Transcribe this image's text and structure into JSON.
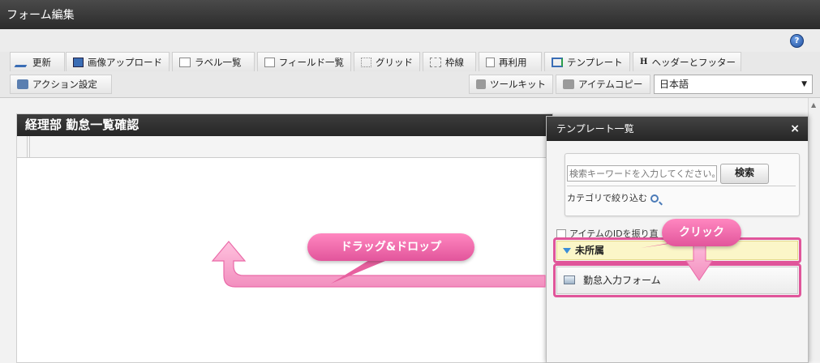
{
  "window": {
    "title": "フォーム編集"
  },
  "toolbar": {
    "row1": [
      {
        "label": "更新",
        "icon": "pencil-icon"
      },
      {
        "label": "画像アップロード",
        "icon": "image-upload-icon"
      },
      {
        "label": "ラベル一覧",
        "icon": "label-list-icon"
      },
      {
        "label": "フィールド一覧",
        "icon": "field-list-icon"
      },
      {
        "label": "グリッド",
        "icon": "grid-icon"
      },
      {
        "label": "枠線",
        "icon": "border-icon"
      },
      {
        "label": "再利用",
        "icon": "reuse-icon"
      },
      {
        "label": "テンプレート",
        "icon": "template-icon"
      },
      {
        "label": "ヘッダーとフッター",
        "icon": "header-footer-icon"
      }
    ],
    "action_settings": "アクション設定",
    "toolkit": "ツールキット",
    "item_copy": "アイテムコピー",
    "language": "日本語"
  },
  "form": {
    "title": "経理部 勤怠一覧確認"
  },
  "template_panel": {
    "title": "テンプレート一覧",
    "close": "×",
    "search_placeholder": "検索キーワードを入力してください。",
    "search_button": "検索",
    "category_filter": "カテゴリで絞り込む",
    "checkbox_label": "アイテムのIDを振り直",
    "group": "未所属",
    "item": "勤怠入力フォーム"
  },
  "callouts": {
    "drag": "ドラッグ&ドロップ",
    "click": "クリック"
  },
  "colors": {
    "accent_pink": "#e0559a",
    "header_dark": "#2b2b2b",
    "group_yellow": "#fbf6c8"
  }
}
